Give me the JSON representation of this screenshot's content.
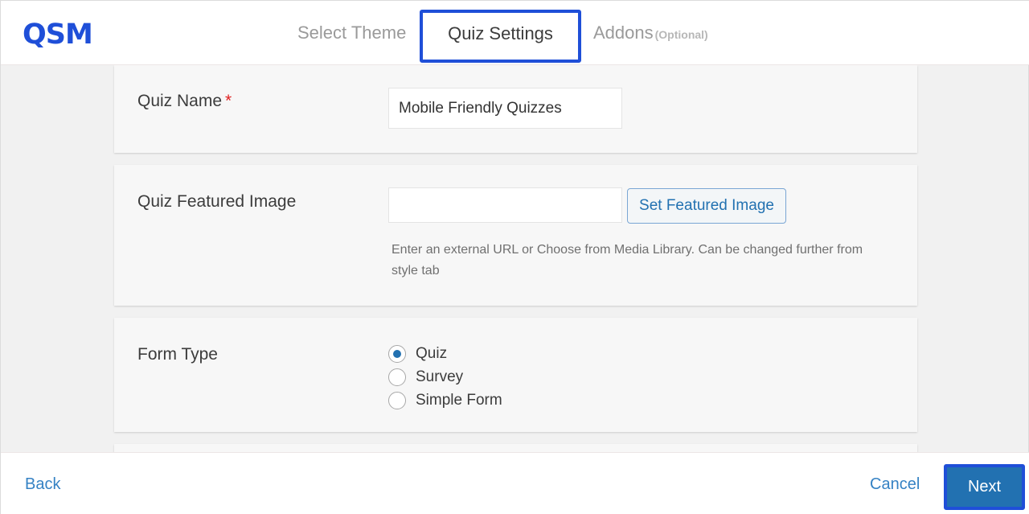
{
  "header": {
    "logo": "QSM",
    "tabs": [
      {
        "label": "Select Theme",
        "active": false
      },
      {
        "label": "Quiz Settings",
        "active": true
      },
      {
        "label": "Addons",
        "suffix": "(Optional)",
        "active": false
      }
    ]
  },
  "form": {
    "quiz_name": {
      "label": "Quiz Name",
      "required_mark": "*",
      "value": "Mobile Friendly Quizzes"
    },
    "featured_image": {
      "label": "Quiz Featured Image",
      "value": "",
      "button_label": "Set Featured Image",
      "help": "Enter an external URL or Choose from Media Library. Can be changed further from style tab"
    },
    "form_type": {
      "label": "Form Type",
      "options": [
        {
          "label": "Quiz",
          "selected": true
        },
        {
          "label": "Survey",
          "selected": false
        },
        {
          "label": "Simple Form",
          "selected": false
        }
      ]
    }
  },
  "footer": {
    "back_label": "Back",
    "cancel_label": "Cancel",
    "next_label": "Next"
  },
  "colors": {
    "accent": "#2271b1",
    "highlight": "#1f4fd8",
    "required": "#e02020"
  }
}
